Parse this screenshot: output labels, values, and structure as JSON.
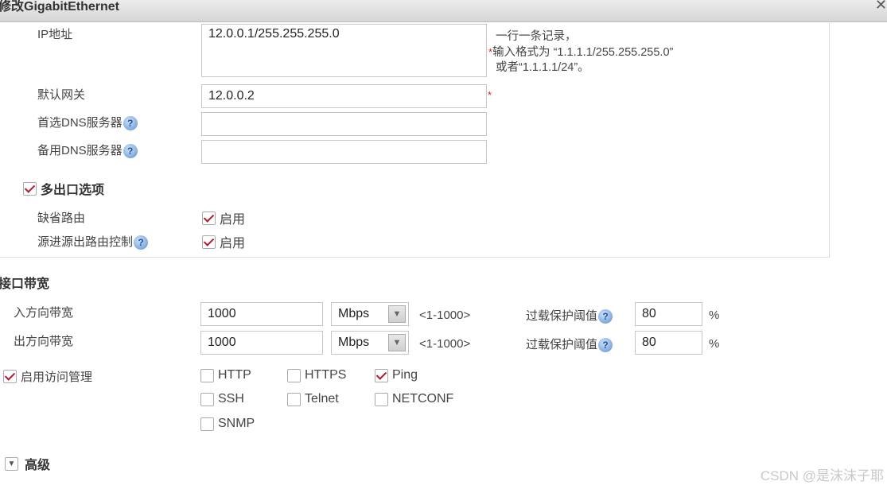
{
  "dialog": {
    "title": "修改GigabitEthernet",
    "close": "✕"
  },
  "ip": {
    "label": "IP地址",
    "value": "12.0.0.1/255.255.255.0",
    "hint1": "一行一条记录，",
    "hint2": "输入格式为 “1.1.1.1/255.255.255.0”",
    "hint3": "或者“1.1.1.1/24”。",
    "required": "*"
  },
  "gateway": {
    "label": "默认网关",
    "value": "12.0.0.2",
    "required": "*"
  },
  "dns1": {
    "label": "首选DNS服务器",
    "value": ""
  },
  "dns2": {
    "label": "备用DNS服务器",
    "value": ""
  },
  "help": "?",
  "multi": {
    "label": "多出口选项",
    "checked": true,
    "default_route": {
      "label": "缺省路由",
      "option": "启用",
      "checked": true
    },
    "source_route": {
      "label": "源进源出路由控制",
      "option": "启用",
      "checked": true
    }
  },
  "bandwidth": {
    "section": "接口带宽",
    "rows": [
      {
        "label": "入方向带宽",
        "value": "1000",
        "unit": "Mbps",
        "range": "<1-1000>",
        "overload_label": "过载保护阈值",
        "overload": "80",
        "pct": "%"
      },
      {
        "label": "出方向带宽",
        "value": "1000",
        "unit": "Mbps",
        "range": "<1-1000>",
        "overload_label": "过载保护阈值",
        "overload": "80",
        "pct": "%"
      }
    ]
  },
  "access": {
    "label": "启用访问管理",
    "checked": true,
    "protocols": [
      {
        "name": "HTTP",
        "checked": false
      },
      {
        "name": "HTTPS",
        "checked": false
      },
      {
        "name": "Ping",
        "checked": true
      },
      {
        "name": "SSH",
        "checked": false
      },
      {
        "name": "Telnet",
        "checked": false
      },
      {
        "name": "NETCONF",
        "checked": false
      },
      {
        "name": "SNMP",
        "checked": false
      }
    ]
  },
  "advanced": {
    "label": "高级"
  },
  "watermark": "CSDN @是沫沫子耶"
}
